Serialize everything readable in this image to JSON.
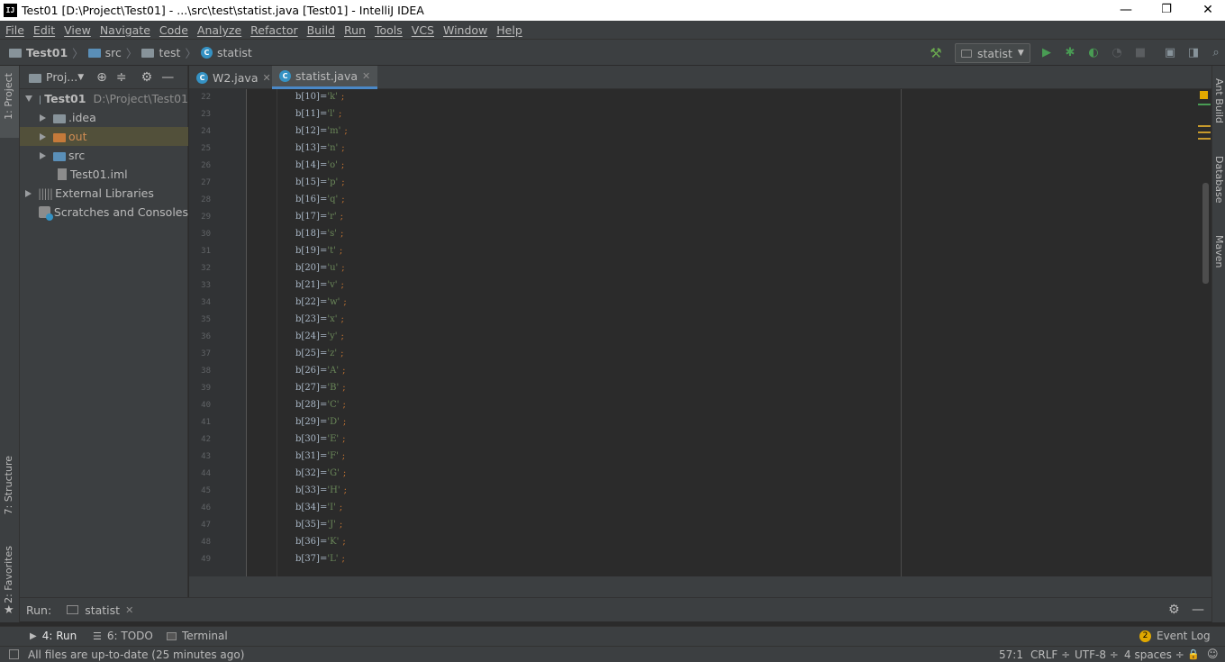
{
  "window": {
    "title": "Test01 [D:\\Project\\Test01] - ...\\src\\test\\statist.java [Test01] - IntelliJ IDEA",
    "logo_text": "IJ",
    "minimize": "—",
    "restore": "❐",
    "close": "✕"
  },
  "menu": [
    "File",
    "Edit",
    "View",
    "Navigate",
    "Code",
    "Analyze",
    "Refactor",
    "Build",
    "Run",
    "Tools",
    "VCS",
    "Window",
    "Help"
  ],
  "breadcrumb": {
    "project": "Test01",
    "src": "src",
    "test": "test",
    "file": "statist"
  },
  "toolbar": {
    "run_config": "statist"
  },
  "project_panel": {
    "title": "Proj...",
    "tree": [
      {
        "label": "Test01",
        "path": "D:\\Project\\Test01"
      },
      {
        "label": ".idea"
      },
      {
        "label": "out"
      },
      {
        "label": "src"
      },
      {
        "label": "Test01.iml"
      },
      {
        "label": "External Libraries"
      },
      {
        "label": "Scratches and Consoles"
      }
    ]
  },
  "left_strip": {
    "project": "1: Project",
    "structure": "7: Structure",
    "favorites": "2: Favorites"
  },
  "right_strip": {
    "ant": "Ant Build",
    "database": "Database",
    "maven": "Maven"
  },
  "tabs": [
    {
      "label": "W2.java"
    },
    {
      "label": "statist.java"
    }
  ],
  "editor": {
    "lines": [
      {
        "n": "22",
        "idx": "10",
        "ch": "k"
      },
      {
        "n": "23",
        "idx": "11",
        "ch": "l"
      },
      {
        "n": "24",
        "idx": "12",
        "ch": "m"
      },
      {
        "n": "25",
        "idx": "13",
        "ch": "n"
      },
      {
        "n": "26",
        "idx": "14",
        "ch": "o"
      },
      {
        "n": "27",
        "idx": "15",
        "ch": "p"
      },
      {
        "n": "28",
        "idx": "16",
        "ch": "q"
      },
      {
        "n": "29",
        "idx": "17",
        "ch": "r"
      },
      {
        "n": "30",
        "idx": "18",
        "ch": "s"
      },
      {
        "n": "31",
        "idx": "19",
        "ch": "t"
      },
      {
        "n": "32",
        "idx": "20",
        "ch": "u"
      },
      {
        "n": "33",
        "idx": "21",
        "ch": "v"
      },
      {
        "n": "34",
        "idx": "22",
        "ch": "w"
      },
      {
        "n": "35",
        "idx": "23",
        "ch": "x"
      },
      {
        "n": "36",
        "idx": "24",
        "ch": "y"
      },
      {
        "n": "37",
        "idx": "25",
        "ch": "z"
      },
      {
        "n": "38",
        "idx": "26",
        "ch": "A"
      },
      {
        "n": "39",
        "idx": "27",
        "ch": "B"
      },
      {
        "n": "40",
        "idx": "28",
        "ch": "C"
      },
      {
        "n": "41",
        "idx": "29",
        "ch": "D"
      },
      {
        "n": "42",
        "idx": "30",
        "ch": "E"
      },
      {
        "n": "43",
        "idx": "31",
        "ch": "F"
      },
      {
        "n": "44",
        "idx": "32",
        "ch": "G"
      },
      {
        "n": "45",
        "idx": "33",
        "ch": "H"
      },
      {
        "n": "46",
        "idx": "34",
        "ch": "I"
      },
      {
        "n": "47",
        "idx": "35",
        "ch": "J"
      },
      {
        "n": "48",
        "idx": "36",
        "ch": "K"
      },
      {
        "n": "49",
        "idx": "37",
        "ch": "L"
      }
    ]
  },
  "run_panel": {
    "label": "Run:",
    "tab": "statist"
  },
  "tool_tabs": {
    "run": "4: Run",
    "todo": "6: TODO",
    "terminal": "Terminal",
    "event_log": "Event Log",
    "event_count": "2"
  },
  "status": {
    "message": "All files are up-to-date (25 minutes ago)",
    "position": "57:1",
    "line_sep": "CRLF ÷",
    "encoding": "UTF-8 ÷",
    "indent": "4 spaces ÷"
  },
  "colors": {
    "accent": "#4a88c7",
    "string": "#6a8759",
    "code": "#a9b7c6",
    "run": "#499c54",
    "warning": "#e0a800"
  }
}
